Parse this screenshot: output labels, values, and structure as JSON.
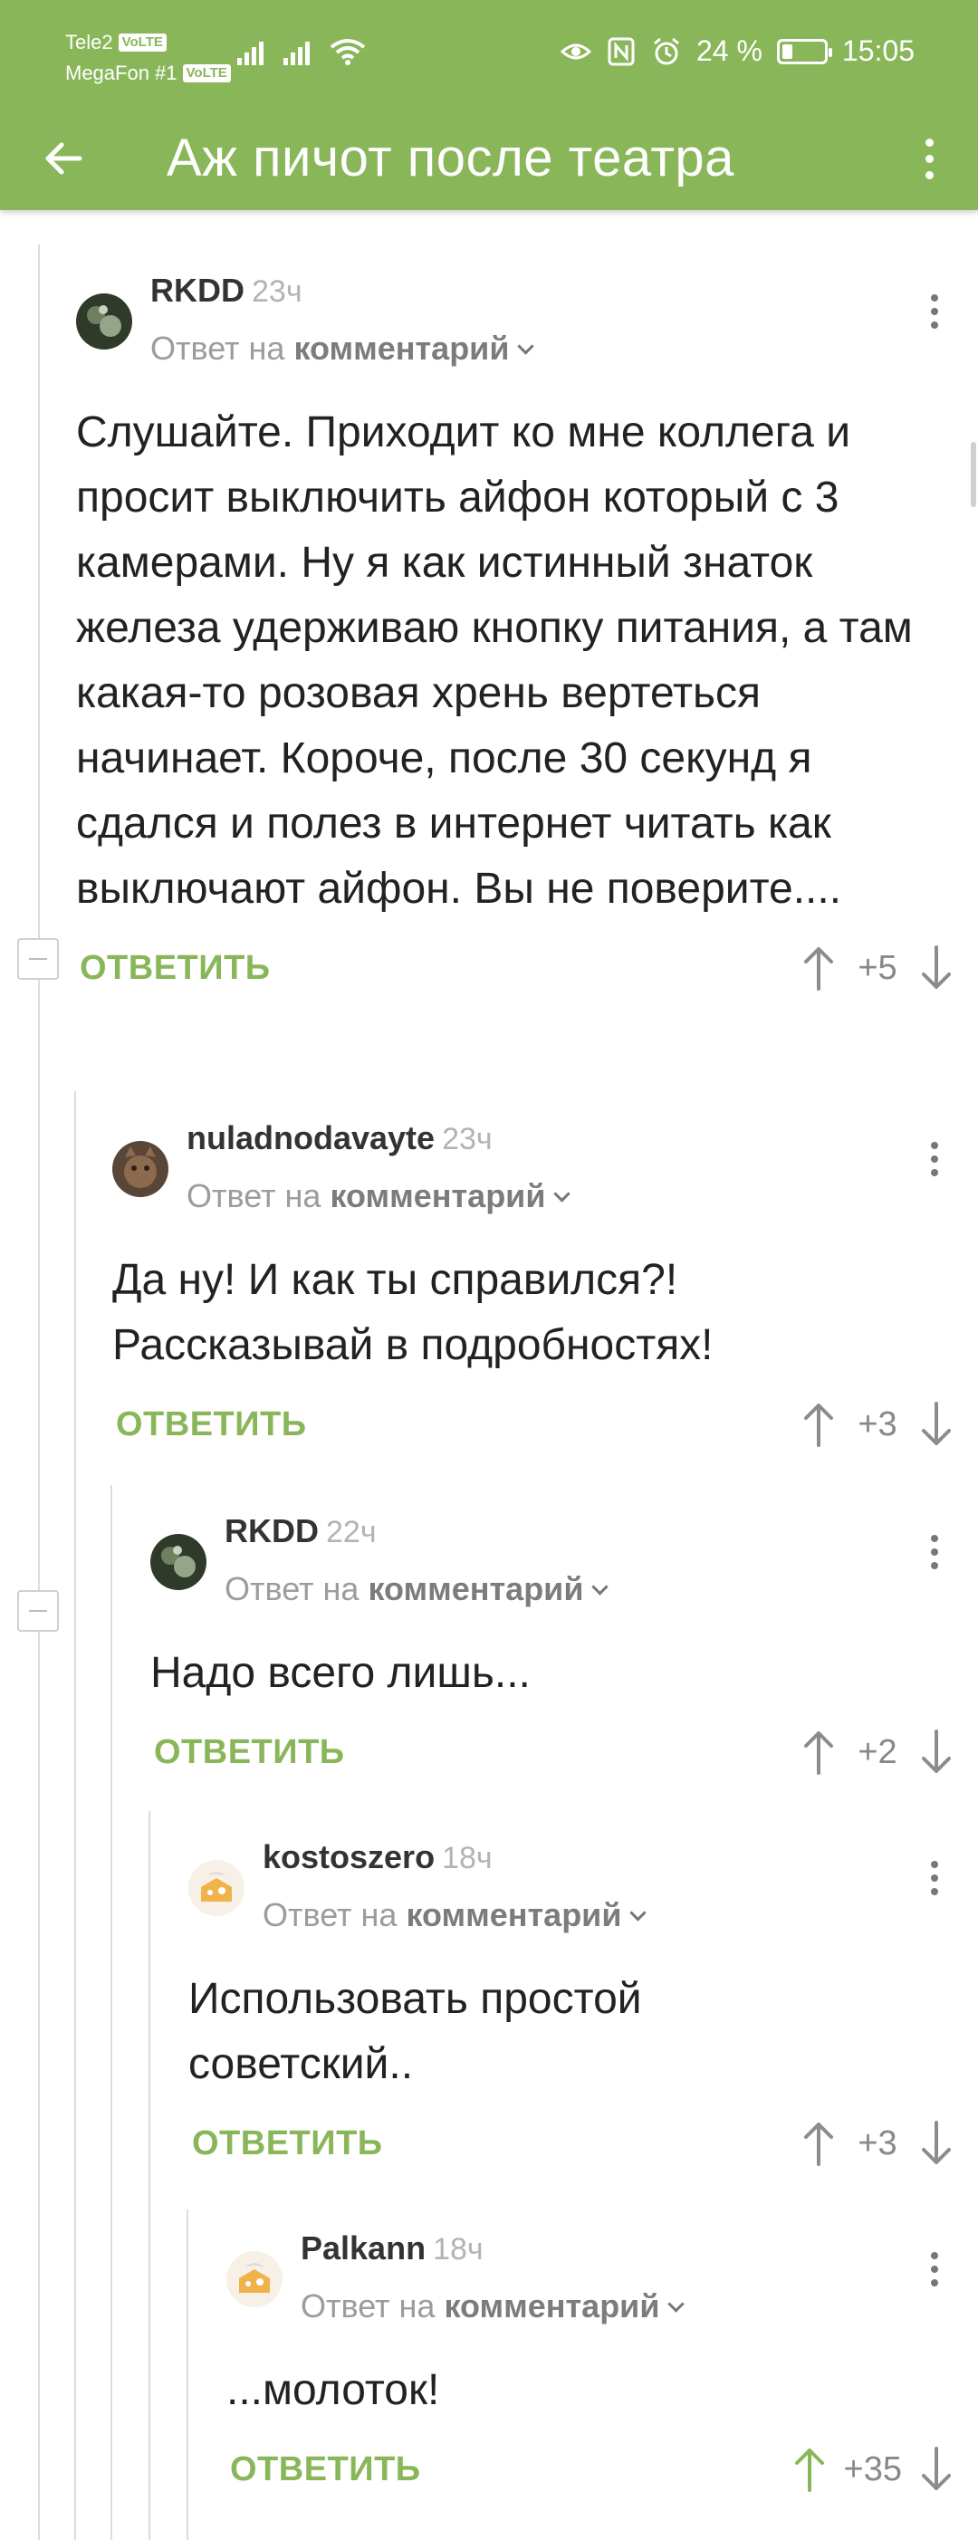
{
  "status_bar": {
    "carrier1": "Tele2",
    "carrier2": "MegaFon #1",
    "volte": "VoLTE",
    "battery_text": "24 %",
    "battery_level": 0.24,
    "time": "15:05"
  },
  "app_bar": {
    "title": "Аж пичот после театра"
  },
  "colors": {
    "brand_green": "#8ab65a",
    "text": "#222222",
    "muted": "#9c9c9c"
  },
  "comments": [
    {
      "author": "RKDD",
      "time": "23ч",
      "reply_prefix": "Ответ на",
      "reply_target": "комментарий",
      "text": "Слушайте. Приходит ко мне коллега и просит выключить айфон который с 3 камерами. Ну я как истинный знаток железа удерживаю кнопку питания, а там какая-то розовая хрень вертеться начинает. Короче, после 30 секунд я сдался и полез в интернет читать как выключают айфон. Вы не поверите....",
      "reply_label": "ОТВЕТИТЬ",
      "score": "+5"
    },
    {
      "author": "nuladnodavayte",
      "time": "23ч",
      "reply_prefix": "Ответ на",
      "reply_target": "комментарий",
      "text": "Да ну! И как ты справился?! Рассказывай в подробностях!",
      "reply_label": "ОТВЕТИТЬ",
      "score": "+3"
    },
    {
      "author": "RKDD",
      "time": "22ч",
      "reply_prefix": "Ответ на",
      "reply_target": "комментарий",
      "text": "Надо всего лишь...",
      "reply_label": "ОТВЕТИТЬ",
      "score": "+2"
    },
    {
      "author": "kostoszero",
      "time": "18ч",
      "reply_prefix": "Ответ на",
      "reply_target": "комментарий",
      "text": "Использовать простой советский..",
      "reply_label": "ОТВЕТИТЬ",
      "score": "+3"
    },
    {
      "author": "Palkann",
      "time": "18ч",
      "reply_prefix": "Ответ на",
      "reply_target": "комментарий",
      "text": "...молоток!",
      "reply_label": "ОТВЕТИТЬ",
      "score": "+35"
    }
  ]
}
